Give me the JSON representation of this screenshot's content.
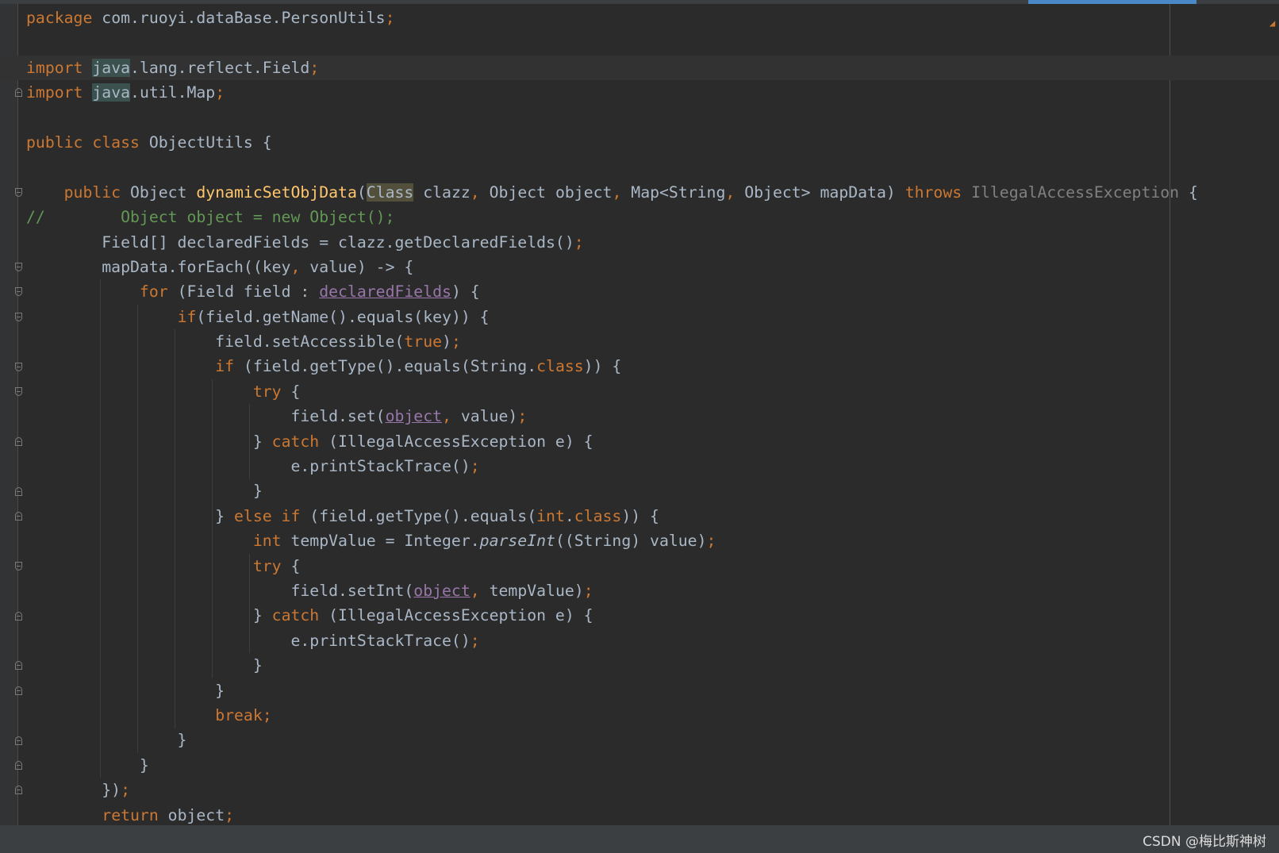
{
  "editor": {
    "lines": [
      {
        "tokens": [
          {
            "t": "package",
            "c": "kw"
          },
          {
            "t": " com.ruoyi.dataBase.PersonUtils"
          },
          {
            "t": ";",
            "c": "kw"
          }
        ]
      },
      {
        "tokens": []
      },
      {
        "hl": true,
        "tokens": [
          {
            "t": "import",
            "c": "kw"
          },
          {
            "t": " "
          },
          {
            "t": "java",
            "c": "hlbox"
          },
          {
            "t": ".lang.reflect.Field"
          },
          {
            "t": ";",
            "c": "kw"
          }
        ]
      },
      {
        "tokens": [
          {
            "t": "import",
            "c": "kw"
          },
          {
            "t": " "
          },
          {
            "t": "java",
            "c": "hlbox"
          },
          {
            "t": ".util.Map"
          },
          {
            "t": ";",
            "c": "kw"
          }
        ]
      },
      {
        "tokens": []
      },
      {
        "tokens": [
          {
            "t": "public class",
            "c": "kw"
          },
          {
            "t": " ObjectUtils {"
          }
        ]
      },
      {
        "tokens": []
      },
      {
        "tokens": [
          {
            "t": "    "
          },
          {
            "t": "public",
            "c": "kw"
          },
          {
            "t": " Object "
          },
          {
            "t": "dynamicSetObjData",
            "c": "fn"
          },
          {
            "t": "("
          },
          {
            "t": "Class",
            "c": "hlbox2"
          },
          {
            "t": " clazz"
          },
          {
            "t": ",",
            "c": "kw"
          },
          {
            "t": " Object object"
          },
          {
            "t": ",",
            "c": "kw"
          },
          {
            "t": " Map<String"
          },
          {
            "t": ",",
            "c": "kw"
          },
          {
            "t": " Object> mapData) "
          },
          {
            "t": "throws",
            "c": "kw"
          },
          {
            "t": " "
          },
          {
            "t": "IllegalAccessException",
            "c": "gr"
          },
          {
            "t": " {"
          }
        ]
      },
      {
        "tokens": [
          {
            "t": "//        Object object = new Object();",
            "c": "cm"
          }
        ]
      },
      {
        "tokens": [
          {
            "t": "        Field[] declaredFields = clazz.getDeclaredFields()"
          },
          {
            "t": ";",
            "c": "kw"
          }
        ]
      },
      {
        "tokens": [
          {
            "t": "        mapData.forEach((key"
          },
          {
            "t": ",",
            "c": "kw"
          },
          {
            "t": " value) -> {"
          }
        ]
      },
      {
        "tokens": [
          {
            "t": "            "
          },
          {
            "t": "for",
            "c": "kw"
          },
          {
            "t": " (Field field : "
          },
          {
            "t": "declaredFields",
            "c": "fld"
          },
          {
            "t": ") {"
          }
        ]
      },
      {
        "tokens": [
          {
            "t": "                "
          },
          {
            "t": "if",
            "c": "kw"
          },
          {
            "t": "(field.getName().equals(key)) {"
          }
        ]
      },
      {
        "tokens": [
          {
            "t": "                    field.setAccessible("
          },
          {
            "t": "true",
            "c": "kw"
          },
          {
            "t": ")"
          },
          {
            "t": ";",
            "c": "kw"
          }
        ]
      },
      {
        "tokens": [
          {
            "t": "                    "
          },
          {
            "t": "if",
            "c": "kw"
          },
          {
            "t": " (field.getType().equals(String."
          },
          {
            "t": "class",
            "c": "kw"
          },
          {
            "t": ")) {"
          }
        ]
      },
      {
        "tokens": [
          {
            "t": "                        "
          },
          {
            "t": "try",
            "c": "kw"
          },
          {
            "t": " {"
          }
        ]
      },
      {
        "tokens": [
          {
            "t": "                            field.set("
          },
          {
            "t": "object",
            "c": "fld"
          },
          {
            "t": ",",
            "c": "kw"
          },
          {
            "t": " value)"
          },
          {
            "t": ";",
            "c": "kw"
          }
        ]
      },
      {
        "tokens": [
          {
            "t": "                        } "
          },
          {
            "t": "catch",
            "c": "kw"
          },
          {
            "t": " (IllegalAccessException e) {"
          }
        ]
      },
      {
        "tokens": [
          {
            "t": "                            e.printStackTrace()"
          },
          {
            "t": ";",
            "c": "kw"
          }
        ]
      },
      {
        "tokens": [
          {
            "t": "                        }"
          }
        ]
      },
      {
        "tokens": [
          {
            "t": "                    } "
          },
          {
            "t": "else if",
            "c": "kw"
          },
          {
            "t": " (field.getType().equals("
          },
          {
            "t": "int",
            "c": "kw"
          },
          {
            "t": "."
          },
          {
            "t": "class",
            "c": "kw"
          },
          {
            "t": ")) {"
          }
        ]
      },
      {
        "tokens": [
          {
            "t": "                        "
          },
          {
            "t": "int",
            "c": "kw"
          },
          {
            "t": " tempValue = Integer."
          },
          {
            "t": "parseInt",
            "c": "it"
          },
          {
            "t": "((String) value)"
          },
          {
            "t": ";",
            "c": "kw"
          }
        ]
      },
      {
        "tokens": [
          {
            "t": "                        "
          },
          {
            "t": "try",
            "c": "kw"
          },
          {
            "t": " {"
          }
        ]
      },
      {
        "tokens": [
          {
            "t": "                            field.setInt("
          },
          {
            "t": "object",
            "c": "fld"
          },
          {
            "t": ",",
            "c": "kw"
          },
          {
            "t": " tempValue)"
          },
          {
            "t": ";",
            "c": "kw"
          }
        ]
      },
      {
        "tokens": [
          {
            "t": "                        } "
          },
          {
            "t": "catch",
            "c": "kw"
          },
          {
            "t": " (IllegalAccessException e) {"
          }
        ]
      },
      {
        "tokens": [
          {
            "t": "                            e.printStackTrace()"
          },
          {
            "t": ";",
            "c": "kw"
          }
        ]
      },
      {
        "tokens": [
          {
            "t": "                        }"
          }
        ]
      },
      {
        "tokens": [
          {
            "t": "                    }"
          }
        ]
      },
      {
        "tokens": [
          {
            "t": "                    "
          },
          {
            "t": "break;",
            "c": "kw"
          }
        ]
      },
      {
        "tokens": [
          {
            "t": "                }"
          }
        ]
      },
      {
        "tokens": [
          {
            "t": "            }"
          }
        ]
      },
      {
        "tokens": [
          {
            "t": "        })"
          },
          {
            "t": ";",
            "c": "kw"
          }
        ]
      },
      {
        "tokens": [
          {
            "t": "        "
          },
          {
            "t": "return",
            "c": "kw"
          },
          {
            "t": " object"
          },
          {
            "t": ";",
            "c": "kw"
          }
        ]
      }
    ],
    "folds": [
      {
        "line": 2,
        "kind": "open"
      },
      {
        "line": 3,
        "kind": "close"
      },
      {
        "line": 7,
        "kind": "open"
      },
      {
        "line": 10,
        "kind": "open"
      },
      {
        "line": 11,
        "kind": "open"
      },
      {
        "line": 12,
        "kind": "open"
      },
      {
        "line": 14,
        "kind": "open"
      },
      {
        "line": 15,
        "kind": "open"
      },
      {
        "line": 17,
        "kind": "close"
      },
      {
        "line": 19,
        "kind": "close"
      },
      {
        "line": 20,
        "kind": "close"
      },
      {
        "line": 22,
        "kind": "open"
      },
      {
        "line": 24,
        "kind": "close"
      },
      {
        "line": 26,
        "kind": "close"
      },
      {
        "line": 27,
        "kind": "close"
      },
      {
        "line": 29,
        "kind": "close"
      },
      {
        "line": 30,
        "kind": "close"
      },
      {
        "line": 31,
        "kind": "close"
      }
    ]
  },
  "watermark": "CSDN @梅比斯神树"
}
